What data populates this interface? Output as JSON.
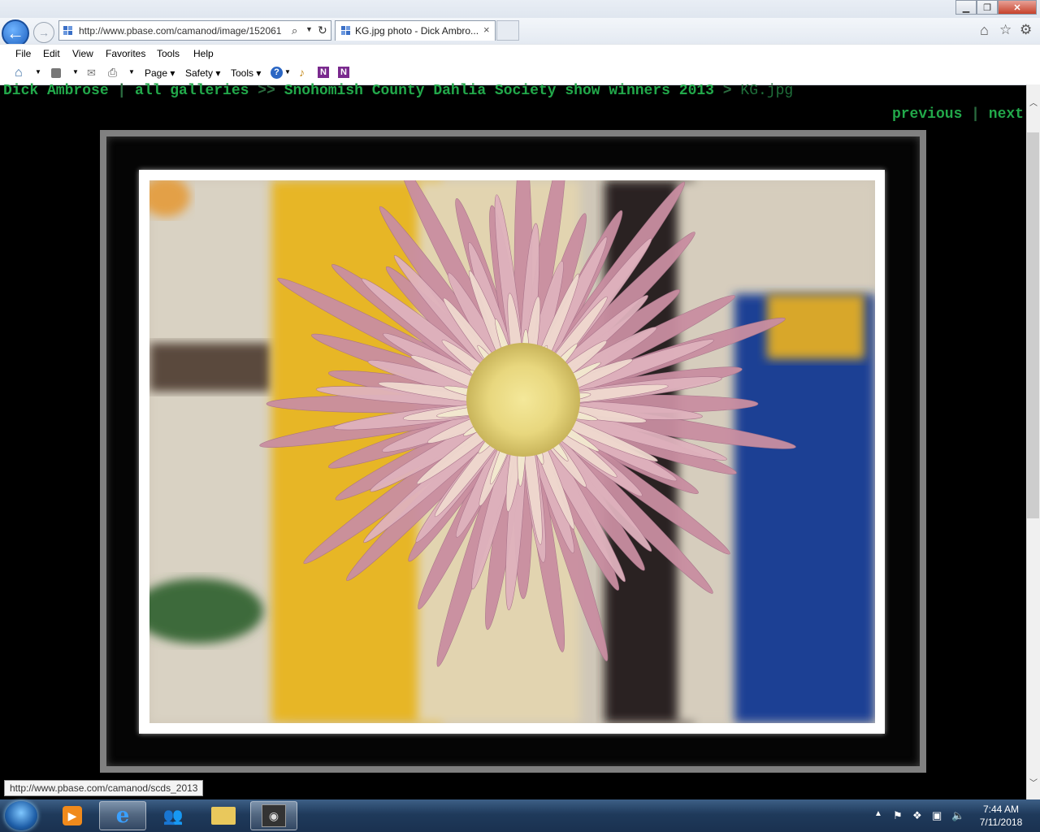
{
  "browser": {
    "url": "http://www.pbase.com/camanod/image/152061",
    "tab_title": "KG.jpg photo - Dick Ambro...",
    "tab_close": "×",
    "window_buttons": {
      "minimize": "▁",
      "restore": "❐",
      "close": "✕"
    }
  },
  "menubar": [
    "File",
    "Edit",
    "View",
    "Favorites",
    "Tools",
    "Help"
  ],
  "commandbar": {
    "page": "Page",
    "safety": "Safety",
    "tools": "Tools"
  },
  "page": {
    "breadcrumb": {
      "owner": "Dick Ambrose",
      "sep1": " | ",
      "galleries": "all galleries",
      "sep2": " >> ",
      "gallery": "Snohomish County Dahlia Society show winners 2013",
      "sep3": " > ",
      "current": "KG.jpg"
    },
    "pager": {
      "previous": "previous",
      "sep": " | ",
      "next": "next"
    }
  },
  "status_tooltip": "http://www.pbase.com/camanod/scds_2013",
  "taskbar": {
    "time": "7:44 AM",
    "date": "7/11/2018"
  },
  "colors": {
    "link": "#22a84a",
    "page_bg": "#000000",
    "photo_frame": "#808080"
  }
}
